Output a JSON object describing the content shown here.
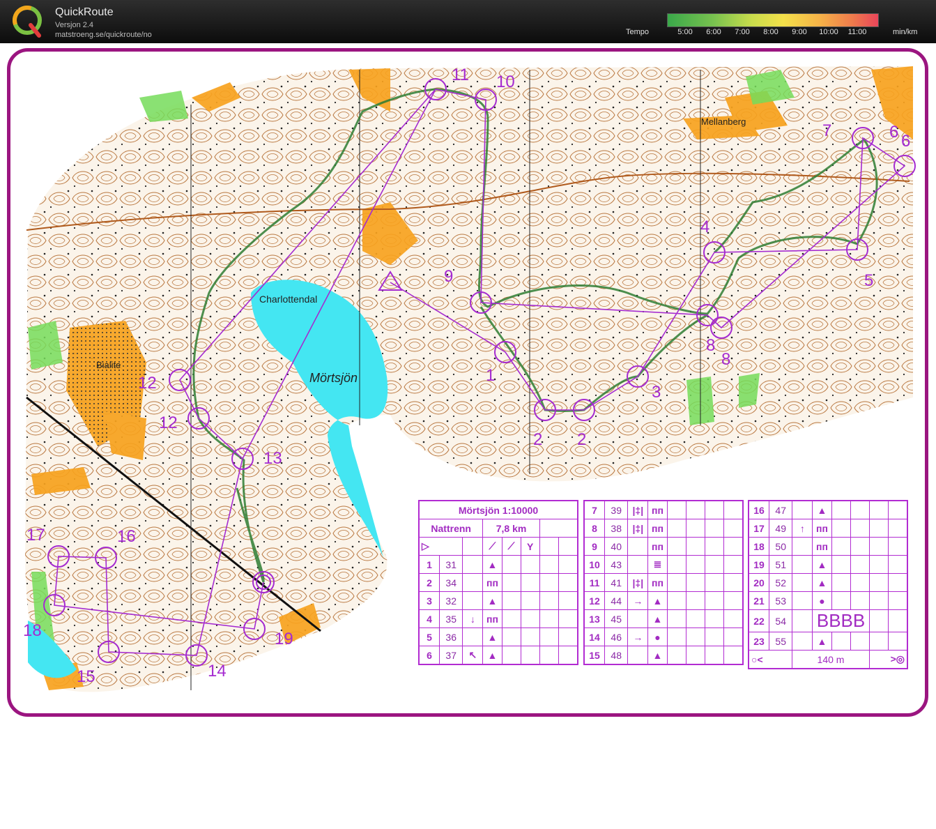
{
  "app": {
    "title": "QuickRoute",
    "version": "Versjon 2.4",
    "url": "matstroeng.se/quickroute/no"
  },
  "tempo": {
    "label": "Tempo",
    "ticks": [
      "5:00",
      "6:00",
      "7:00",
      "8:00",
      "9:00",
      "10:00",
      "11:00"
    ],
    "unit": "min/km"
  },
  "map": {
    "places": [
      "Charlottendal",
      "Mörtsjön",
      "Bialite",
      "Mellanberg"
    ],
    "control_labels": [
      "1",
      "2",
      "2",
      "3",
      "4",
      "5",
      "6",
      "6",
      "7",
      "8",
      "8",
      "9",
      "10",
      "11",
      "12",
      "12",
      "13",
      "14",
      "15",
      "16",
      "17",
      "18",
      "19"
    ]
  },
  "description": {
    "title": "Mörtsjön 1:10000",
    "class": "Nattrenn",
    "length": "7,8 km",
    "rows": [
      {
        "n": "1",
        "code": "31",
        "col4": "",
        "feature": "▲"
      },
      {
        "n": "2",
        "code": "34",
        "col4": "",
        "feature": "ᴨᴨ"
      },
      {
        "n": "3",
        "code": "32",
        "col4": "",
        "feature": "▲"
      },
      {
        "n": "4",
        "code": "35",
        "col4": "↓",
        "feature": "ᴨᴨ"
      },
      {
        "n": "5",
        "code": "36",
        "col4": "",
        "feature": "▲"
      },
      {
        "n": "6",
        "code": "37",
        "col4": "↖",
        "feature": "▲"
      },
      {
        "n": "7",
        "code": "39",
        "col4": "|‡|",
        "feature": "ᴨᴨ"
      },
      {
        "n": "8",
        "code": "38",
        "col4": "|‡|",
        "feature": "ᴨᴨ"
      },
      {
        "n": "9",
        "code": "40",
        "col4": "",
        "feature": "ᴨᴨ"
      },
      {
        "n": "10",
        "code": "43",
        "col4": "",
        "feature": "≣"
      },
      {
        "n": "11",
        "code": "41",
        "col4": "|‡|",
        "feature": "ᴨᴨ"
      },
      {
        "n": "12",
        "code": "44",
        "col4": "→",
        "feature": "▲"
      },
      {
        "n": "13",
        "code": "45",
        "col4": "",
        "feature": "▲"
      },
      {
        "n": "14",
        "code": "46",
        "col4": "→",
        "feature": "●"
      },
      {
        "n": "15",
        "code": "48",
        "col4": "",
        "feature": "▲"
      },
      {
        "n": "16",
        "code": "47",
        "col4": "",
        "feature": "▲"
      },
      {
        "n": "17",
        "code": "49",
        "col4": "↑",
        "feature": "ᴨᴨ"
      },
      {
        "n": "18",
        "code": "50",
        "col4": "",
        "feature": "ᴨᴨ"
      },
      {
        "n": "19",
        "code": "51",
        "col4": "",
        "feature": "▲"
      },
      {
        "n": "20",
        "code": "52",
        "col4": "",
        "feature": "▲"
      },
      {
        "n": "21",
        "code": "53",
        "col4": "",
        "feature": "●"
      },
      {
        "n": "22",
        "code": "54",
        "col4": "",
        "feature": "BBBB"
      },
      {
        "n": "23",
        "code": "55",
        "col4": "",
        "feature": "▲"
      }
    ],
    "finish_distance": "140 m"
  },
  "colors": {
    "course": "#a52bd0",
    "frame": "#9b1580",
    "water": "#44e6f2",
    "open": "#f7a21e",
    "route": "#2e7d32"
  }
}
